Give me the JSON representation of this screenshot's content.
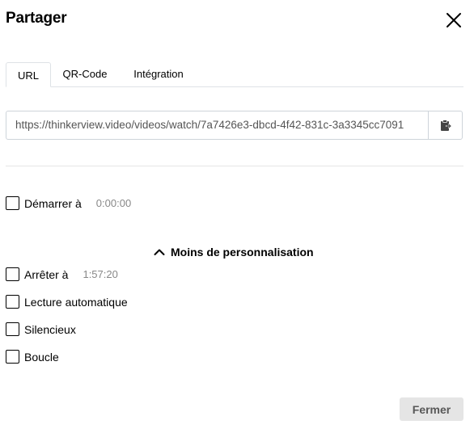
{
  "dialog": {
    "title": "Partager",
    "close_icon": "close-icon"
  },
  "tabs": [
    {
      "label": "URL",
      "active": true
    },
    {
      "label": "QR-Code",
      "active": false
    },
    {
      "label": "Intégration",
      "active": false
    }
  ],
  "url": {
    "value": "https://thinkerview.video/videos/watch/7a7426e3-dbcd-4f42-831c-3a3345cc7091",
    "copy_icon": "clipboard-icon"
  },
  "options": {
    "start": {
      "label": "Démarrer à",
      "time": "0:00:00",
      "checked": false
    },
    "toggle_label": "Moins de personnalisation",
    "toggle_icon": "chevron-up-icon",
    "stop": {
      "label": "Arrêter à",
      "time": "1:57:20",
      "checked": false
    },
    "autoplay": {
      "label": "Lecture automatique",
      "checked": false
    },
    "muted": {
      "label": "Silencieux",
      "checked": false
    },
    "loop": {
      "label": "Boucle",
      "checked": false
    }
  },
  "footer": {
    "close_label": "Fermer"
  },
  "colors": {
    "border": "#dee2e6",
    "button_bg": "#e5e5e5",
    "muted_text": "#888888"
  }
}
